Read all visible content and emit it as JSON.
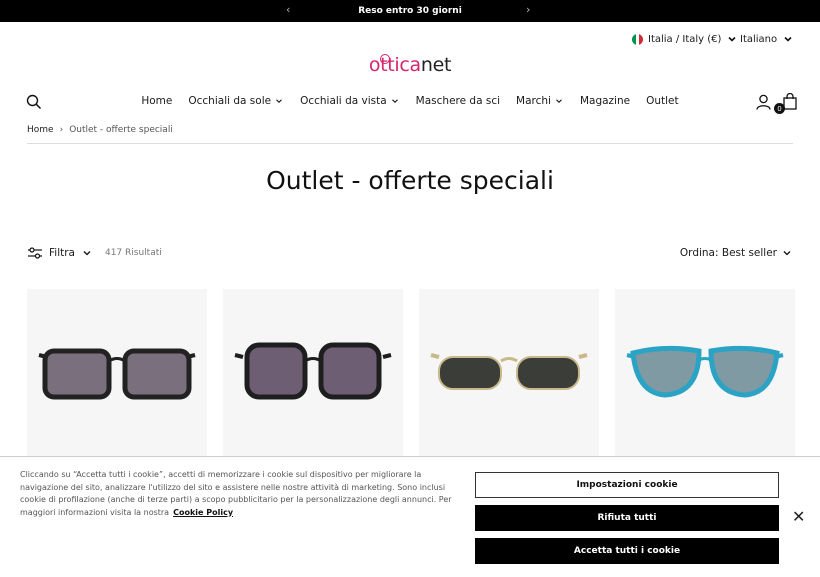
{
  "announcement": {
    "text": "Reso entro 30 giorni"
  },
  "utility": {
    "country": "Italia / Italy (€)",
    "language": "Italiano"
  },
  "logo": {
    "part1": "ottica",
    "part2": "net"
  },
  "nav": [
    {
      "label": "Home",
      "dropdown": false
    },
    {
      "label": "Occhiali da sole",
      "dropdown": true
    },
    {
      "label": "Occhiali da vista",
      "dropdown": true
    },
    {
      "label": "Maschere da sci",
      "dropdown": false
    },
    {
      "label": "Marchi",
      "dropdown": true
    },
    {
      "label": "Magazine",
      "dropdown": false
    },
    {
      "label": "Outlet",
      "dropdown": false
    }
  ],
  "cart": {
    "count": "0"
  },
  "breadcrumb": {
    "home": "Home",
    "sep": "›",
    "current": "Outlet - offerte speciali"
  },
  "page": {
    "title": "Outlet - offerte speciali"
  },
  "toolbar": {
    "filter_label": "Filtra",
    "results": "417 Risultati",
    "sort_label": "Ordina: Best seller"
  },
  "products": [
    {
      "frame": "#222222",
      "lens": "#7a6f7c",
      "style": "square"
    },
    {
      "frame": "#1e1e1e",
      "lens": "#6e5e74",
      "style": "oversized"
    },
    {
      "frame": "#c9b88a",
      "lens": "#3a3d38",
      "style": "metal-oval"
    },
    {
      "frame": "#2aa3c4",
      "lens": "#7f9aa2",
      "style": "cat-eye"
    }
  ],
  "cookie": {
    "text": "Cliccando su “Accetta tutti i cookie”, accetti di memorizzare i cookie sul dispositivo per migliorare la navigazione del sito, analizzare l'utilizzo del sito e assistere nelle nostre attività di marketing. Sono inclusi cookie di profilazione (anche di terze parti) a scopo pubblicitario per la personalizzazione degli annunci. Per maggiori informazioni visita la nostra",
    "link": "Cookie Policy",
    "settings": "Impostazioni cookie",
    "reject": "Rifiuta tutti",
    "accept": "Accetta tutti i cookie",
    "close": "✕"
  },
  "colors": {
    "brand": "#d6246e",
    "dark": "#000000"
  }
}
